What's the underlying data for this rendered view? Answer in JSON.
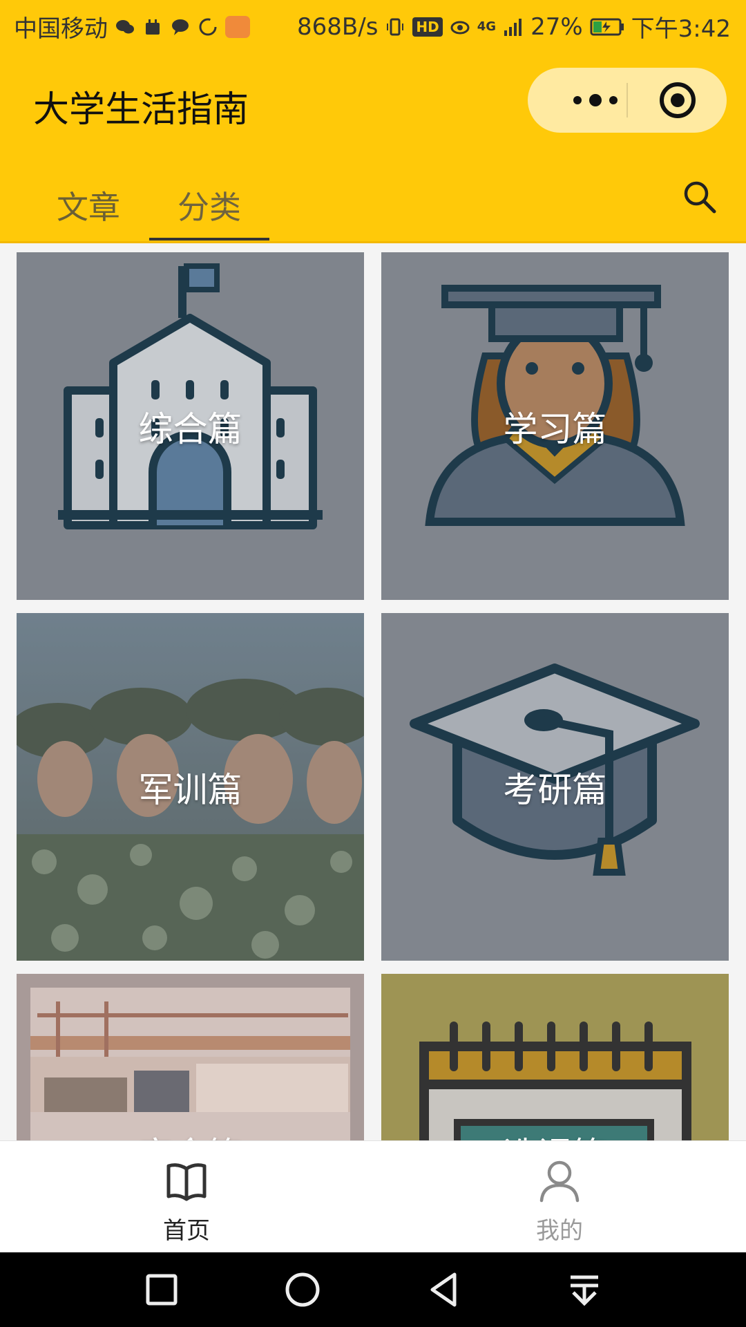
{
  "statusbar": {
    "carrier": "中国移动",
    "net_speed": "868B/s",
    "hd": "HD",
    "signal": "4G",
    "battery": "27%",
    "time": "下午3:42"
  },
  "header": {
    "title": "大学生活指南",
    "more_icon": "ellipsis-icon",
    "close_icon": "target-close-icon"
  },
  "tabs": [
    {
      "label": "文章",
      "active": false
    },
    {
      "label": "分类",
      "active": true
    }
  ],
  "categories": [
    {
      "label": "综合篇",
      "icon": "school-building-icon"
    },
    {
      "label": "学习篇",
      "icon": "graduate-student-icon"
    },
    {
      "label": "军训篇",
      "icon": "military-training-photo"
    },
    {
      "label": "考研篇",
      "icon": "graduation-cap-icon"
    },
    {
      "label": "宿舍篇",
      "icon": "dormitory-photo"
    },
    {
      "label": "选课篇",
      "icon": "calendar-icon"
    }
  ],
  "tabbar": {
    "home_label": "首页",
    "me_label": "我的"
  },
  "colors": {
    "brand": "#ffc909",
    "card_overlay": "#7f848c"
  }
}
